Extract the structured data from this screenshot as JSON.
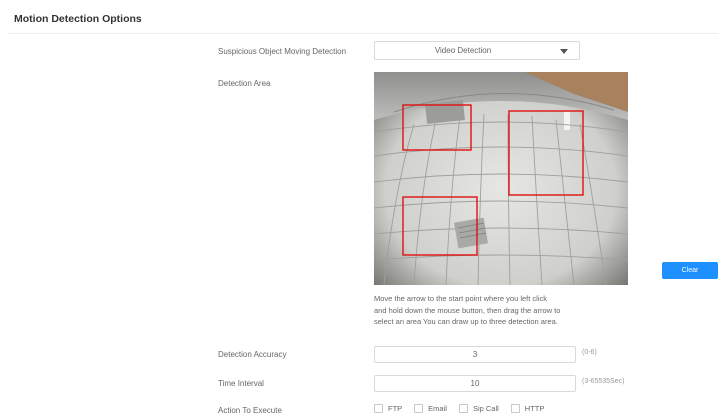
{
  "section": {
    "title": "Motion Detection Options"
  },
  "suspicious": {
    "label": "Suspicious Object Moving Detection",
    "selected": "Video Detection"
  },
  "detection_area": {
    "label": "Detection Area",
    "region_count": 3,
    "region_color": "#e01010"
  },
  "clear_button": {
    "label": "Clear",
    "color": "#1e90ff"
  },
  "hint": {
    "line1": "Move the arrow to the start point where you left click",
    "line2": "and hold down the mouse button, then drag the arrow to",
    "line3": "select an area You can draw up to three detection area."
  },
  "accuracy": {
    "label": "Detection Accuracy",
    "value": "3",
    "range": "(0-6)"
  },
  "interval": {
    "label": "Time Interval",
    "value": "10",
    "range": "(3-65535Sec)"
  },
  "action": {
    "label": "Action To Execute",
    "options": [
      "FTP",
      "Email",
      "Sip Call",
      "HTTP"
    ]
  }
}
